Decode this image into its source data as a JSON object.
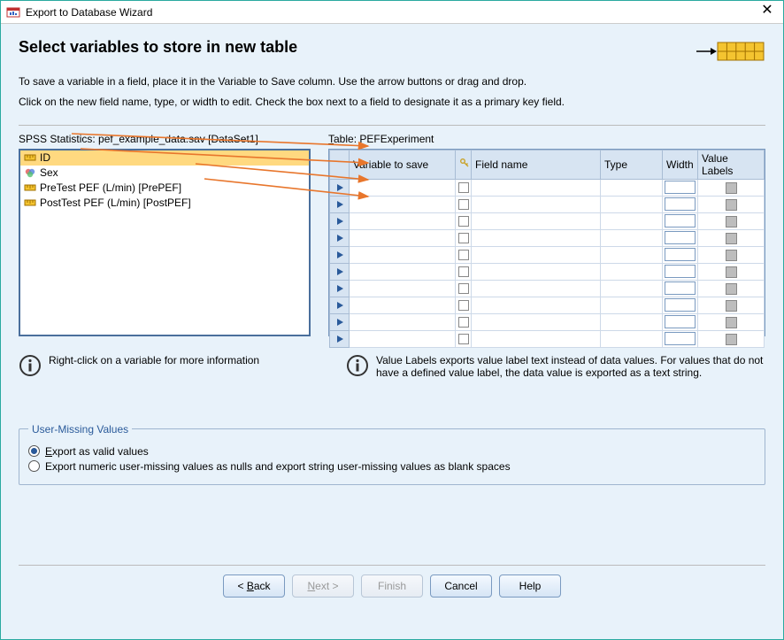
{
  "window": {
    "title": "Export to Database Wizard"
  },
  "header": {
    "page_title": "Select variables to store in new table"
  },
  "instructions": {
    "line1": "To save a variable in a field, place it in the Variable to Save column. Use the arrow buttons or drag and drop.",
    "line2": "Click on the new field name, type, or width to edit. Check the box next to a field to designate it as a primary key field."
  },
  "left_panel": {
    "label_prefix": "SPSS Statistics:  ",
    "label_file": "pef_example_data.sav [DataSet1]",
    "variables": [
      {
        "label": "ID",
        "icon": "ruler",
        "selected": true
      },
      {
        "label": "Sex",
        "icon": "venn",
        "selected": false
      },
      {
        "label": "PreTest PEF (L/min) [PrePEF]",
        "icon": "ruler",
        "selected": false
      },
      {
        "label": "PostTest PEF (L/min) [PostPEF]",
        "icon": "ruler",
        "selected": false
      }
    ]
  },
  "right_panel": {
    "label_prefix": "Table: ",
    "label_mnemonic": "T",
    "table_name": "PEFExperiment",
    "columns": {
      "variable_to_save": "Variable to save",
      "field_name": "Field name",
      "type": "Type",
      "width": "Width",
      "value_labels": "Value Labels"
    },
    "row_count": 10
  },
  "hints": {
    "left": "Right-click on a variable for more information",
    "right": "Value Labels exports value label text instead of data values. For values that do not have a defined value label, the data value is exported as a text string."
  },
  "missing_values": {
    "legend": "User-Missing Values",
    "opt_valid": "Export as valid values",
    "opt_valid_mnemonic": "E",
    "opt_nulls": "Export numeric user-missing values as nulls and export string user-missing values as blank spaces",
    "selected": "valid"
  },
  "buttons": {
    "back": "< Back",
    "back_mnemonic": "B",
    "next": "Next >",
    "next_mnemonic": "N",
    "finish": "Finish",
    "cancel": "Cancel",
    "help": "Help"
  }
}
